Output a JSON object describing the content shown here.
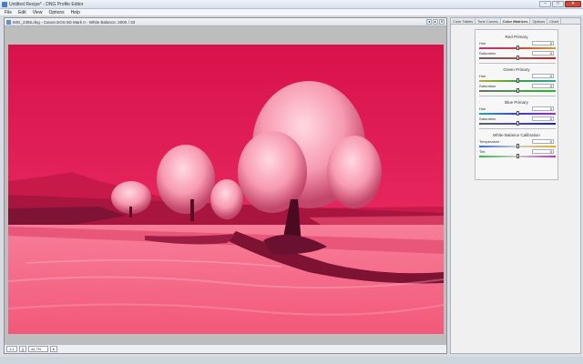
{
  "window": {
    "title": "Untitled Recipe* - DNG Profile Editor",
    "minimize": "–",
    "maximize": "□",
    "close": "✕"
  },
  "menu": [
    "File",
    "Edit",
    "View",
    "Options",
    "Help"
  ],
  "document": {
    "title": "IMG_2355.dng - Canon EOS 5D Mark II - White Balance: 2000 / 33",
    "buttons": [
      "◂",
      "▸",
      "✕"
    ]
  },
  "status": {
    "fit_label": "1:1",
    "fit2_label": "[]",
    "zoom": "44.7%",
    "arrow": "▾"
  },
  "panel": {
    "tabs": [
      "Color Tables",
      "Tone Curves",
      "Color Matrices",
      "Options",
      "Chart"
    ],
    "active_tab": 2,
    "sections": [
      {
        "title": "Red Primary",
        "rows": [
          {
            "label": "Hue",
            "value": "0",
            "pos": 0.5,
            "gradient": [
              "#c3307a",
              "#d43a3a",
              "#c9a030"
            ]
          },
          {
            "label": "Saturation",
            "value": "0",
            "pos": 0.5,
            "gradient": [
              "#6a5f5f",
              "#b04a4a",
              "#d21c1c"
            ]
          }
        ]
      },
      {
        "title": "Green Primary",
        "rows": [
          {
            "label": "Hue",
            "value": "0",
            "pos": 0.5,
            "gradient": [
              "#b8b030",
              "#3aa23a",
              "#2da6a0"
            ]
          },
          {
            "label": "Saturation",
            "value": "0",
            "pos": 0.5,
            "gradient": [
              "#667066",
              "#4a9a4a",
              "#1cbf1c"
            ]
          }
        ]
      },
      {
        "title": "Blue Primary",
        "rows": [
          {
            "label": "Hue",
            "value": "0",
            "pos": 0.5,
            "gradient": [
              "#2aa8b0",
              "#3a3ad4",
              "#9a30c3"
            ]
          },
          {
            "label": "Saturation",
            "value": "0",
            "pos": 0.5,
            "gradient": [
              "#5f5f6a",
              "#4a4ab0",
              "#1c1cd2"
            ]
          }
        ]
      },
      {
        "title": "White Balance Calibration",
        "rows": [
          {
            "label": "Temperature",
            "value": "0",
            "pos": 0.5,
            "gradient": [
              "#2f6fd8",
              "#cccccc",
              "#e0b020"
            ]
          },
          {
            "label": "Tint",
            "value": "0",
            "pos": 0.5,
            "gradient": [
              "#2cbf3a",
              "#cccccc",
              "#c02cc0"
            ]
          }
        ]
      }
    ]
  }
}
